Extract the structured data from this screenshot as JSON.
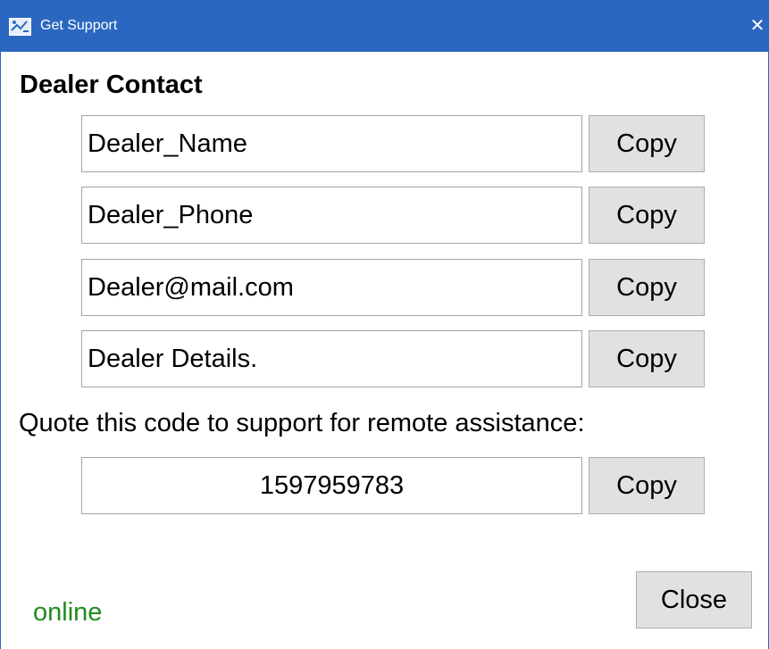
{
  "window": {
    "title": "Get Support",
    "close_glyph": "✕",
    "app_icon": "support-app-icon",
    "titlebar_color": "#2b67c0"
  },
  "dealer_contact": {
    "heading": "Dealer Contact",
    "fields": [
      {
        "value": "Dealer_Name",
        "copy_label": "Copy"
      },
      {
        "value": "Dealer_Phone",
        "copy_label": "Copy"
      },
      {
        "value": "Dealer@mail.com",
        "copy_label": "Copy"
      },
      {
        "value": "Dealer Details.",
        "copy_label": "Copy"
      }
    ]
  },
  "remote": {
    "prompt": "Quote this code to support for remote assistance:",
    "code": "1597959783",
    "copy_label": "Copy"
  },
  "footer": {
    "status": "online",
    "status_color": "#1f8a1f",
    "close_label": "Close"
  }
}
